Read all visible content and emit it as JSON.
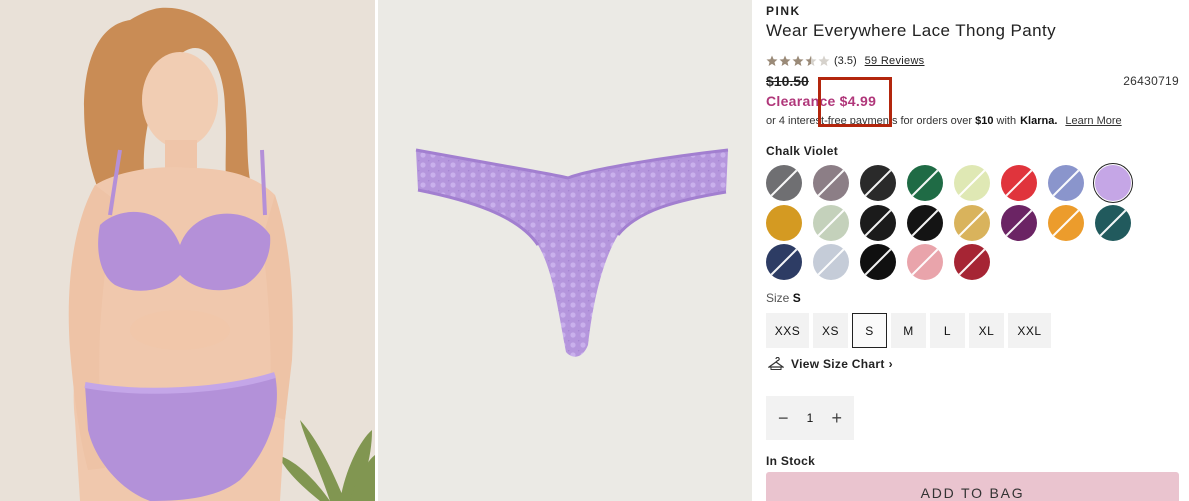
{
  "product": {
    "brand": "PINK",
    "title": "Wear Everywhere Lace Thong Panty",
    "rating_value": "(3.5)",
    "rating_stars": 3.5,
    "reviews_label": "59 Reviews",
    "original_price": "$10.50",
    "sku": "26430719",
    "clearance_label": "Clearance",
    "clearance_price": "$4.99",
    "klarna": {
      "text_before": "or 4 interest-free payments for orders over",
      "threshold": "$10",
      "text_with": "with",
      "logo": "Klarna.",
      "learn_more": "Learn More"
    }
  },
  "colors": {
    "selected_name": "Chalk Violet",
    "swatches": [
      {
        "name": "gray-lace-print",
        "color": "#6f6f72",
        "unavailable": true
      },
      {
        "name": "mauve-gray-print",
        "color": "#8c7e86",
        "unavailable": true
      },
      {
        "name": "black-floral",
        "color": "#2a2a2a",
        "unavailable": true
      },
      {
        "name": "forest-green",
        "color": "#1f6b45",
        "unavailable": true
      },
      {
        "name": "lime-cream",
        "color": "#dfe8b4",
        "unavailable": true
      },
      {
        "name": "red",
        "color": "#e0343c",
        "unavailable": true
      },
      {
        "name": "periwinkle",
        "color": "#8a95cc",
        "unavailable": true
      },
      {
        "name": "chalk-violet",
        "color": "#c5a6e6",
        "unavailable": false,
        "selected": true
      },
      {
        "name": "mustard",
        "color": "#d49a22",
        "unavailable": false
      },
      {
        "name": "sage",
        "color": "#c4d1bb",
        "unavailable": true
      },
      {
        "name": "black-gold-print",
        "color": "#1b1b1b",
        "unavailable": true
      },
      {
        "name": "black",
        "color": "#141414",
        "unavailable": true
      },
      {
        "name": "gold",
        "color": "#d9b35c",
        "unavailable": true
      },
      {
        "name": "plum",
        "color": "#6b2464",
        "unavailable": true
      },
      {
        "name": "orange",
        "color": "#ec9c2c",
        "unavailable": true
      },
      {
        "name": "teal",
        "color": "#215a5d",
        "unavailable": true
      },
      {
        "name": "navy-print",
        "color": "#2d3c64",
        "unavailable": true
      },
      {
        "name": "light-blue-gray",
        "color": "#c5ccd8",
        "unavailable": true
      },
      {
        "name": "jet-black",
        "color": "#101010",
        "unavailable": true
      },
      {
        "name": "light-pink",
        "color": "#e9a4ab",
        "unavailable": true
      },
      {
        "name": "crimson",
        "color": "#a62534",
        "unavailable": true
      }
    ]
  },
  "size": {
    "label": "Size",
    "selected": "S",
    "options": [
      "XXS",
      "XS",
      "S",
      "M",
      "L",
      "XL",
      "XXL"
    ],
    "size_chart_label": "View Size Chart"
  },
  "quantity": {
    "value": "1",
    "minus": "−",
    "plus": "+"
  },
  "stock_label": "In Stock",
  "add_to_bag_label": "ADD TO BAG",
  "colors_accent": {
    "clearance": "#b0377a",
    "highlight_box": "#b3260d",
    "add_to_bag_bg": "#eac4cf",
    "stars": "#9a8a78"
  }
}
